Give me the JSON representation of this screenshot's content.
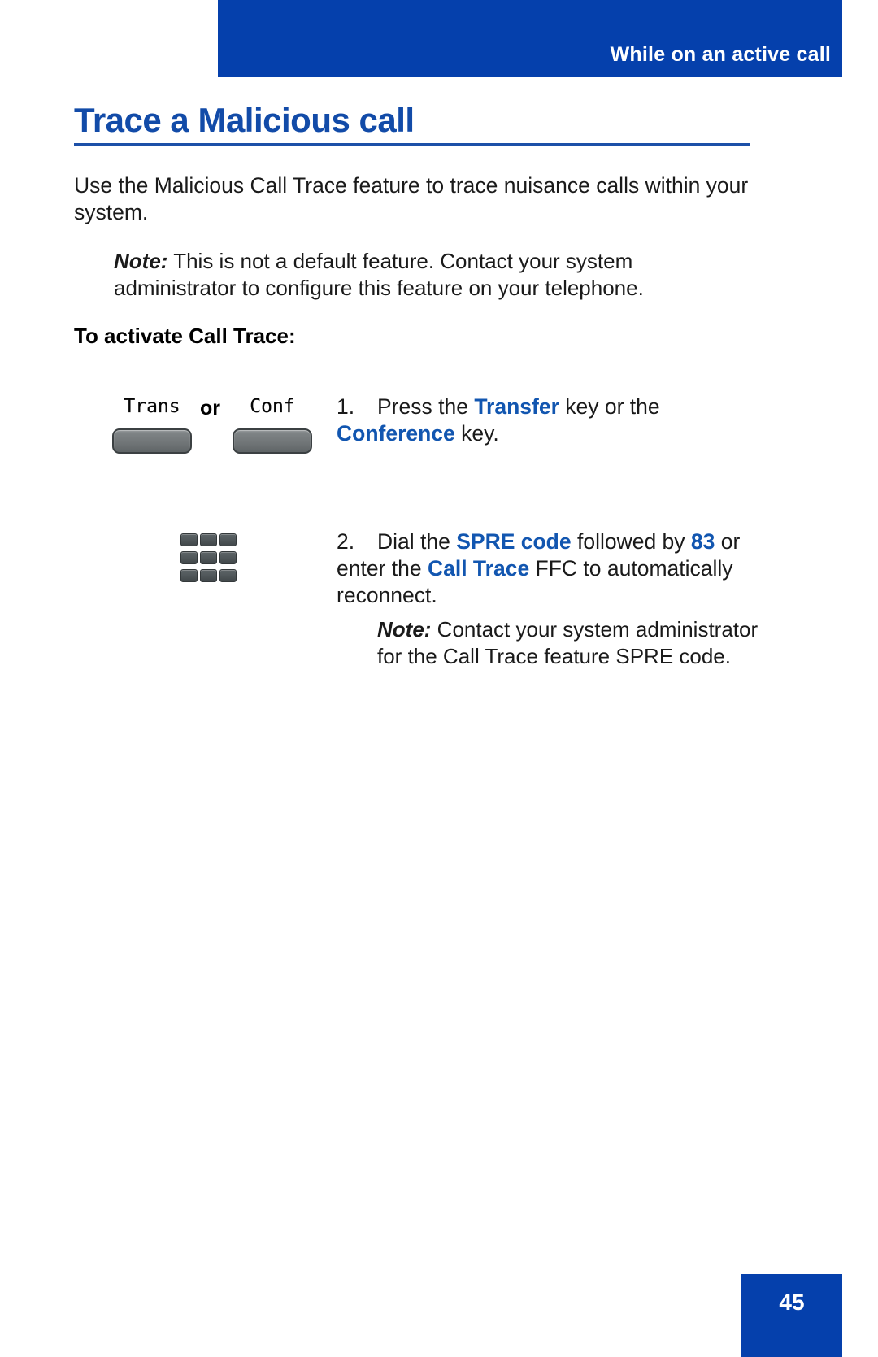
{
  "header": {
    "running_title": "While on an active call",
    "banner_color": "#0540ac"
  },
  "title": {
    "text": "Trace a Malicious call",
    "color": "#124ba8"
  },
  "intro": {
    "paragraph": "Use the Malicious Call Trace feature to trace nuisance calls within your system."
  },
  "note_1": {
    "lead": "Note:",
    "text": "This is not a default feature. Contact your system administrator to configure this feature on your telephone."
  },
  "section": {
    "heading": "To activate Call Trace:"
  },
  "figures": {
    "keys": {
      "trans_label": "Trans",
      "or_label": "or",
      "conf_label": "Conf"
    },
    "keypad": {
      "key_count": 9
    }
  },
  "steps": [
    {
      "number": "1.",
      "part_1": "Press the ",
      "highlight_1": "Transfer",
      "part_2": " key or the ",
      "highlight_2": "Conference",
      "part_3": " key."
    },
    {
      "number": "2.",
      "part_1": "Dial the ",
      "highlight_1": "SPRE code",
      "part_2": " followed by ",
      "highlight_2": "83",
      "part_3": " or enter the ",
      "highlight_3": "Call Trace",
      "part_4": " FFC to automatically reconnect."
    }
  ],
  "note_2": {
    "lead": "Note:",
    "text": "Contact your system administrator for the Call Trace feature SPRE code."
  },
  "footer": {
    "page_number": "45"
  },
  "accent": {
    "blue": "#1256b0",
    "banner_blue": "#0540ac"
  }
}
